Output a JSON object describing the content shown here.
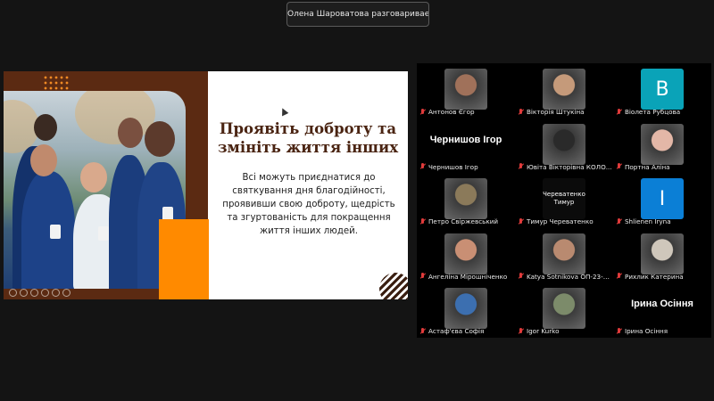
{
  "speaker_notice": "Олена Шароватова разговаривает...",
  "slide": {
    "title": "Проявіть доброту та змініть життя інших",
    "body": "Всі можуть приєднатися до святкування дня благодійності, проявивши свою доброту, щедрість та згуртованість для покращення життя інших людей."
  },
  "participants": [
    {
      "name": "Антонов Єгор",
      "thumb_type": "photo",
      "tone": "#a0715a"
    },
    {
      "name": "Вікторія Штукіна",
      "thumb_type": "photo",
      "tone": "#c59a7a"
    },
    {
      "name": "Віолета Рубцова",
      "thumb_type": "letter",
      "letter": "В",
      "color": "#0aa3b8"
    },
    {
      "name": "Чернишов Ігор",
      "thumb_type": "name",
      "large_name": "Чернишов Ігор"
    },
    {
      "name": "Ювіта Вікторівна КОЛО...",
      "thumb_type": "photo",
      "tone": "#2a2a2a"
    },
    {
      "name": "Портна Аліна",
      "thumb_type": "photo",
      "tone": "#e3b7a7"
    },
    {
      "name": "Петро Свіржевський",
      "thumb_type": "photo",
      "tone": "#8b7a5a"
    },
    {
      "name": "Тимур Череватенко",
      "thumb_type": "text",
      "thumb_text": "Череватенко Тимур"
    },
    {
      "name": "Shlienen Iryna",
      "thumb_type": "letter",
      "letter": "I",
      "color": "#0b7fd6"
    },
    {
      "name": "Ангеліна Мірошніченко",
      "thumb_type": "photo",
      "tone": "#c98f74"
    },
    {
      "name": "Katya Sotnikova ОП-23-5...",
      "thumb_type": "photo",
      "tone": "#b98a70"
    },
    {
      "name": "Рихлик Катерина",
      "thumb_type": "photo",
      "tone": "#cfc7bb"
    },
    {
      "name": "Астаф'єва Софія",
      "thumb_type": "photo",
      "tone": "#3c6fb0"
    },
    {
      "name": "Igor Kurko",
      "thumb_type": "photo",
      "tone": "#7c8b6a"
    },
    {
      "name": "Ірина Осіння",
      "thumb_type": "name",
      "large_name": "Ірина Осіння"
    }
  ]
}
